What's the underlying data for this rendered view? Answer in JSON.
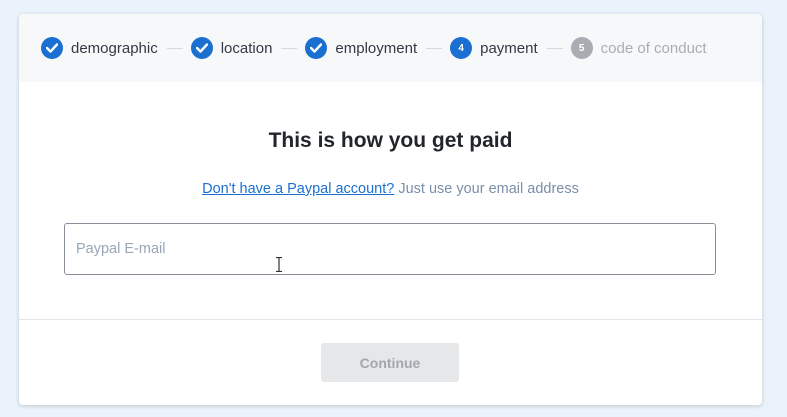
{
  "stepper": {
    "steps": [
      {
        "label": "demographic",
        "state": "complete",
        "icon": "check-icon"
      },
      {
        "label": "location",
        "state": "complete",
        "icon": "check-icon"
      },
      {
        "label": "employment",
        "state": "complete",
        "icon": "check-icon"
      },
      {
        "label": "payment",
        "state": "current",
        "number": "4"
      },
      {
        "label": "code of conduct",
        "state": "upcoming",
        "number": "5"
      }
    ]
  },
  "main": {
    "title": "This is how you get paid",
    "subtitle_link": "Don't have a Paypal account?",
    "subtitle_text": " Just use your email address",
    "email_placeholder": "Paypal E-mail",
    "email_value": ""
  },
  "footer": {
    "continue_label": "Continue",
    "continue_enabled": false
  },
  "colors": {
    "accent": "#1a6fd0",
    "inactive": "#a9adb3",
    "background": "#eaf2fb"
  }
}
